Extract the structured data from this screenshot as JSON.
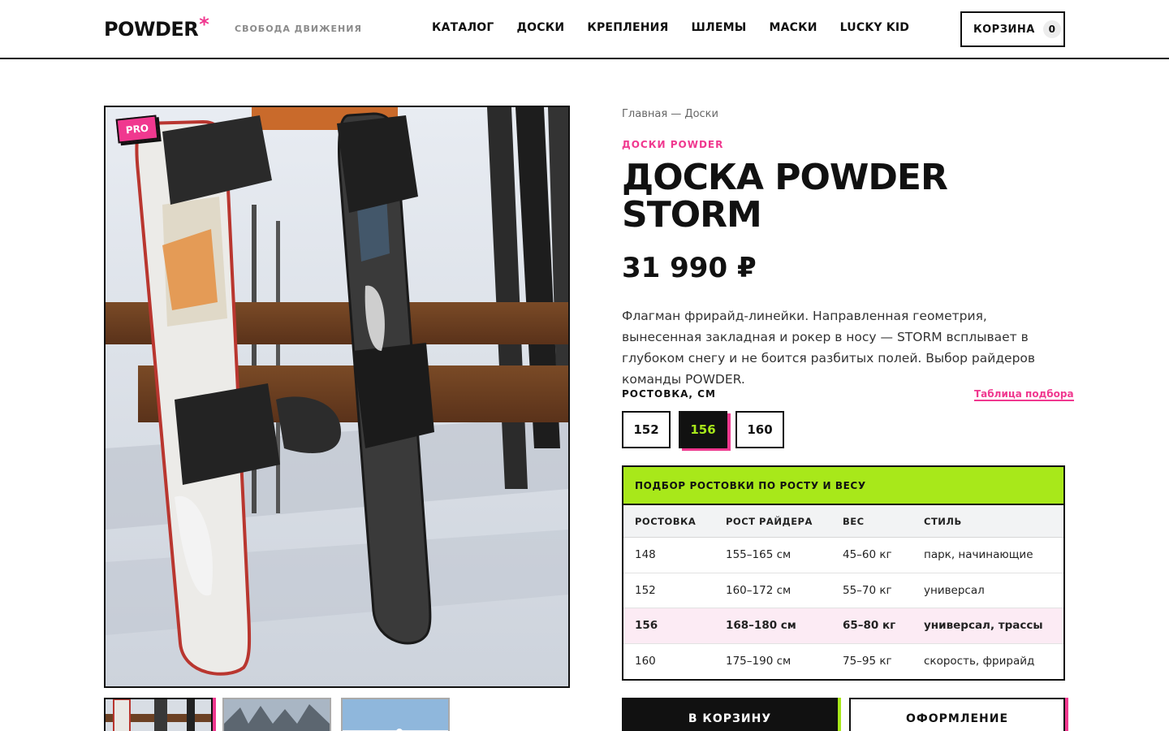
{
  "header": {
    "logo_text": "POWDER",
    "logo_star": "*",
    "tagline": "свобода движения",
    "nav": [
      "КАТАЛОГ",
      "ДОСКИ",
      "КРЕПЛЕНИЯ",
      "ШЛЕМЫ",
      "МАСКИ",
      "LUCKY KID"
    ],
    "cart_label": "КОРЗИНА",
    "cart_count": "0"
  },
  "gallery": {
    "badge": "PRO",
    "thumbnail_count": 3,
    "active_thumbnail": 0
  },
  "product": {
    "breadcrumb": "Главная — Доски",
    "brand": "ДОСКИ POWDER",
    "title": "ДОСКА POWDER STORM",
    "price": "31 990 ₽",
    "description": "Флагман фрирайд-линейки. Направленная геометрия, вынесенная закладная и рокер в носу — STORM всплывает в глубоком снегу и не боится разбитых полей. Выбор райдеров команды POWDER.",
    "size_label": "РОСТОВКА, СМ",
    "size_chart_link": "Таблица подбора",
    "sizes": [
      "152",
      "156",
      "160"
    ],
    "selected_size": "156"
  },
  "size_table": {
    "title": "ПОДБОР РОСТОВКИ ПО РОСТУ И ВЕСУ",
    "columns": [
      "РОСТОВКА",
      "РОСТ РАЙДЕРА",
      "ВЕС",
      "СТИЛЬ"
    ],
    "rows": [
      [
        "148",
        "155–165 см",
        "45–60 кг",
        "парк, начинающие"
      ],
      [
        "152",
        "160–172 см",
        "55–70 кг",
        "универсал"
      ],
      [
        "156",
        "168–180 см",
        "65–80 кг",
        "универсал, трассы"
      ],
      [
        "160",
        "175–190 см",
        "75–95 кг",
        "скорость, фрирайд"
      ]
    ],
    "highlighted_row": 2
  },
  "actions": {
    "add_to_cart": "В КОРЗИНУ",
    "checkout": "ОФОРМЛЕНИЕ"
  },
  "colors": {
    "accent_pink": "#f0388f",
    "accent_lime": "#a8e81a",
    "ink": "#111111"
  }
}
